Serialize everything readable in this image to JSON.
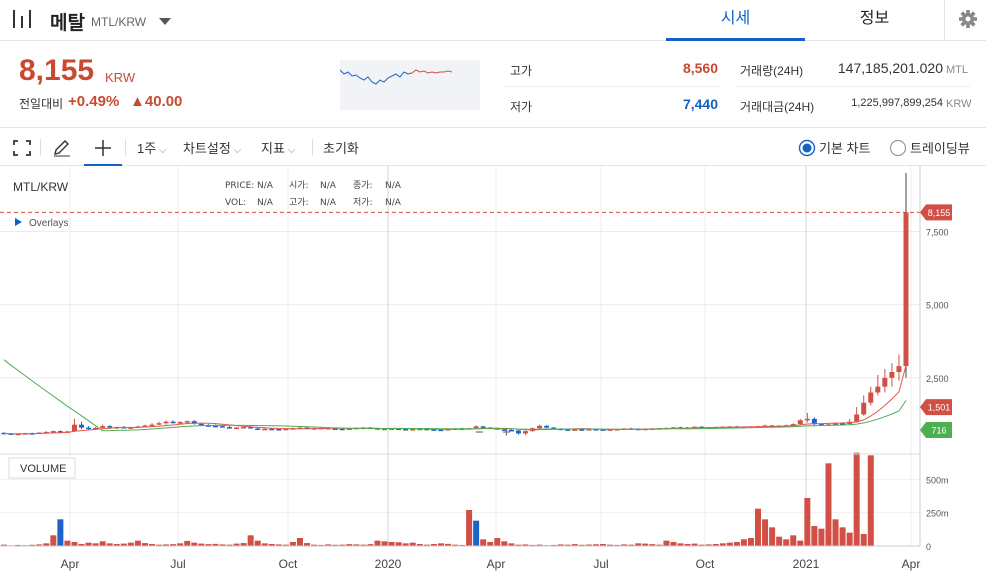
{
  "header": {
    "coin_name": "메탈",
    "pair": "MTL/KRW",
    "tabs": [
      "시세",
      "정보"
    ]
  },
  "summary": {
    "price": "8,155",
    "price_unit": "KRW",
    "change_label": "전일대비",
    "change_pct": "+0.49%",
    "change_abs": "▲40.00",
    "high_label": "고가",
    "high_value": "8,560",
    "low_label": "저가",
    "low_value": "7,440",
    "volume_label": "거래량(24H)",
    "volume_value": "147,185,201.020",
    "volume_unit": "MTL",
    "amount_label": "거래대금(24H)",
    "amount_value": "1,225,997,899,254",
    "amount_unit": "KRW"
  },
  "toolbar": {
    "interval": "1주",
    "chart_settings": "차트설정",
    "indicators": "지표",
    "reset": "초기화",
    "basic_chart": "기본 차트",
    "tradingview": "트레이딩뷰"
  },
  "chart": {
    "symbol": "MTL/KRW",
    "overlays": "Overlays",
    "legend": {
      "price_label": "PRICE:",
      "price_val": "N/A",
      "open_label": "시가:",
      "open_val": "N/A",
      "close_label": "종가:",
      "close_val": "N/A",
      "vol_label": "VOL:",
      "vol_val": "N/A",
      "high_label": "고가:",
      "high_val": "N/A",
      "low_label": "저가:",
      "low_val": "N/A"
    },
    "volume_label": "VOLUME",
    "zoom_out": "−",
    "zoom_in": "+",
    "colors": {
      "up": "#d24f45",
      "down": "#1e64c8",
      "ma_short": "#e8554e",
      "ma_long": "#4caf50",
      "price_tag": "#d24f45",
      "ma_long_tag": "#4caf50"
    }
  },
  "chart_data": {
    "type": "candlestick",
    "y_ticks": [
      "7,500",
      "5,000",
      "2,500"
    ],
    "y_tick_values": [
      7500,
      5000,
      2500
    ],
    "price_tags": [
      {
        "value": 8155,
        "label": "8,155",
        "series": "price"
      },
      {
        "value": 1501,
        "label": "1,501",
        "series": "ma_short"
      },
      {
        "value": 716,
        "label": "716",
        "series": "ma_long"
      }
    ],
    "volume_ticks": [
      "500m",
      "250m",
      "0"
    ],
    "volume_tick_values": [
      500,
      250,
      0
    ],
    "x_ticks": [
      "Apr",
      "Jul",
      "Oct",
      "2020",
      "Apr",
      "Jul",
      "Oct",
      "2021",
      "Apr"
    ],
    "ylim": [
      0,
      9500
    ],
    "volume_ylim": [
      0,
      600
    ],
    "candles": [
      [
        620,
        640,
        580,
        600
      ],
      [
        600,
        610,
        560,
        580
      ],
      [
        580,
        600,
        560,
        590
      ],
      [
        590,
        620,
        580,
        610
      ],
      [
        610,
        630,
        590,
        600
      ],
      [
        600,
        640,
        590,
        630
      ],
      [
        630,
        680,
        610,
        650
      ],
      [
        650,
        700,
        630,
        680
      ],
      [
        680,
        700,
        640,
        660
      ],
      [
        660,
        690,
        640,
        670
      ],
      [
        670,
        1100,
        650,
        900
      ],
      [
        900,
        1000,
        750,
        800
      ],
      [
        800,
        850,
        700,
        760
      ],
      [
        760,
        820,
        720,
        790
      ],
      [
        790,
        900,
        770,
        850
      ],
      [
        850,
        880,
        780,
        800
      ],
      [
        800,
        840,
        760,
        820
      ],
      [
        820,
        850,
        780,
        790
      ],
      [
        790,
        830,
        760,
        810
      ],
      [
        810,
        860,
        790,
        840
      ],
      [
        840,
        900,
        820,
        870
      ],
      [
        870,
        950,
        840,
        900
      ],
      [
        900,
        1000,
        880,
        950
      ],
      [
        950,
        1050,
        900,
        1000
      ],
      [
        1000,
        1050,
        940,
        960
      ],
      [
        960,
        1020,
        920,
        990
      ],
      [
        990,
        1040,
        960,
        1020
      ],
      [
        1020,
        1050,
        900,
        930
      ],
      [
        930,
        960,
        860,
        880
      ],
      [
        880,
        920,
        840,
        860
      ],
      [
        860,
        900,
        820,
        850
      ],
      [
        850,
        870,
        800,
        820
      ],
      [
        820,
        850,
        760,
        780
      ],
      [
        780,
        820,
        750,
        800
      ],
      [
        800,
        840,
        780,
        820
      ],
      [
        820,
        850,
        760,
        770
      ],
      [
        770,
        800,
        720,
        740
      ],
      [
        740,
        780,
        720,
        760
      ],
      [
        760,
        790,
        730,
        750
      ],
      [
        750,
        780,
        720,
        730
      ],
      [
        730,
        770,
        710,
        760
      ],
      [
        760,
        800,
        740,
        780
      ],
      [
        780,
        820,
        760,
        800
      ],
      [
        800,
        830,
        760,
        770
      ],
      [
        770,
        800,
        740,
        780
      ],
      [
        780,
        820,
        760,
        790
      ],
      [
        790,
        820,
        760,
        770
      ],
      [
        770,
        800,
        740,
        760
      ],
      [
        760,
        790,
        730,
        750
      ],
      [
        750,
        780,
        730,
        770
      ],
      [
        770,
        800,
        750,
        790
      ],
      [
        790,
        820,
        770,
        800
      ],
      [
        800,
        820,
        760,
        780
      ],
      [
        780,
        800,
        740,
        750
      ],
      [
        750,
        780,
        720,
        760
      ],
      [
        760,
        790,
        740,
        770
      ],
      [
        770,
        790,
        740,
        750
      ],
      [
        750,
        770,
        720,
        740
      ],
      [
        740,
        760,
        720,
        750
      ],
      [
        750,
        770,
        730,
        760
      ],
      [
        760,
        780,
        730,
        740
      ],
      [
        740,
        760,
        710,
        730
      ],
      [
        730,
        750,
        700,
        720
      ],
      [
        720,
        760,
        700,
        750
      ],
      [
        750,
        780,
        730,
        770
      ],
      [
        770,
        800,
        740,
        760
      ],
      [
        760,
        790,
        740,
        780
      ],
      [
        780,
        880,
        760,
        840
      ],
      [
        840,
        860,
        780,
        800
      ],
      [
        800,
        820,
        760,
        780
      ],
      [
        780,
        800,
        730,
        740
      ],
      [
        740,
        760,
        700,
        720
      ],
      [
        720,
        750,
        680,
        700
      ],
      [
        700,
        720,
        560,
        600
      ],
      [
        600,
        700,
        540,
        680
      ],
      [
        680,
        800,
        660,
        780
      ],
      [
        780,
        900,
        760,
        860
      ],
      [
        860,
        880,
        780,
        800
      ],
      [
        800,
        820,
        740,
        760
      ],
      [
        760,
        780,
        720,
        740
      ],
      [
        740,
        760,
        700,
        720
      ],
      [
        720,
        750,
        700,
        740
      ],
      [
        740,
        760,
        710,
        730
      ],
      [
        730,
        760,
        710,
        750
      ],
      [
        750,
        770,
        720,
        740
      ],
      [
        740,
        760,
        720,
        730
      ],
      [
        730,
        750,
        710,
        740
      ],
      [
        740,
        760,
        720,
        750
      ],
      [
        750,
        780,
        730,
        770
      ],
      [
        770,
        790,
        740,
        760
      ],
      [
        760,
        780,
        740,
        750
      ],
      [
        750,
        770,
        730,
        760
      ],
      [
        760,
        780,
        740,
        770
      ],
      [
        770,
        790,
        750,
        780
      ],
      [
        780,
        800,
        760,
        790
      ],
      [
        790,
        820,
        770,
        810
      ],
      [
        810,
        830,
        780,
        800
      ],
      [
        800,
        820,
        780,
        790
      ],
      [
        790,
        840,
        780,
        830
      ],
      [
        830,
        850,
        790,
        800
      ],
      [
        800,
        820,
        780,
        810
      ],
      [
        810,
        830,
        790,
        820
      ],
      [
        820,
        840,
        800,
        830
      ],
      [
        830,
        850,
        810,
        840
      ],
      [
        840,
        860,
        800,
        820
      ],
      [
        820,
        840,
        790,
        830
      ],
      [
        830,
        850,
        810,
        840
      ],
      [
        840,
        860,
        820,
        850
      ],
      [
        850,
        900,
        830,
        870
      ],
      [
        870,
        890,
        830,
        850
      ],
      [
        850,
        880,
        830,
        870
      ],
      [
        870,
        900,
        850,
        880
      ],
      [
        880,
        950,
        860,
        920
      ],
      [
        920,
        1100,
        900,
        1050
      ],
      [
        1050,
        1300,
        980,
        1100
      ],
      [
        1100,
        1150,
        880,
        920
      ],
      [
        920,
        950,
        860,
        900
      ],
      [
        900,
        930,
        860,
        910
      ],
      [
        910,
        960,
        890,
        940
      ],
      [
        940,
        980,
        900,
        920
      ],
      [
        920,
        1100,
        900,
        1000
      ],
      [
        1000,
        1500,
        980,
        1250
      ],
      [
        1250,
        1900,
        1200,
        1650
      ],
      [
        1650,
        2200,
        1550,
        2000
      ],
      [
        2000,
        2600,
        1900,
        2200
      ],
      [
        2200,
        2800,
        2000,
        2500
      ],
      [
        2500,
        3000,
        2200,
        2700
      ],
      [
        2700,
        3300,
        2400,
        2900
      ],
      [
        2900,
        9500,
        2500,
        8155
      ]
    ],
    "volumes": [
      [
        10,
        1
      ],
      [
        5,
        1
      ],
      [
        8,
        1
      ],
      [
        6,
        1
      ],
      [
        9,
        1
      ],
      [
        12,
        1
      ],
      [
        20,
        1
      ],
      [
        80,
        1
      ],
      [
        200,
        -1
      ],
      [
        40,
        1
      ],
      [
        30,
        1
      ],
      [
        15,
        1
      ],
      [
        25,
        1
      ],
      [
        20,
        1
      ],
      [
        35,
        1
      ],
      [
        20,
        1
      ],
      [
        15,
        1
      ],
      [
        18,
        1
      ],
      [
        25,
        1
      ],
      [
        40,
        1
      ],
      [
        22,
        1
      ],
      [
        15,
        1
      ],
      [
        10,
        1
      ],
      [
        12,
        1
      ],
      [
        14,
        1
      ],
      [
        20,
        1
      ],
      [
        38,
        1
      ],
      [
        25,
        1
      ],
      [
        18,
        1
      ],
      [
        14,
        1
      ],
      [
        16,
        1
      ],
      [
        12,
        1
      ],
      [
        10,
        1
      ],
      [
        18,
        1
      ],
      [
        22,
        1
      ],
      [
        80,
        1
      ],
      [
        40,
        1
      ],
      [
        20,
        1
      ],
      [
        15,
        1
      ],
      [
        12,
        1
      ],
      [
        10,
        1
      ],
      [
        30,
        1
      ],
      [
        60,
        1
      ],
      [
        22,
        1
      ],
      [
        10,
        1
      ],
      [
        8,
        1
      ],
      [
        12,
        1
      ],
      [
        9,
        1
      ],
      [
        10,
        1
      ],
      [
        14,
        1
      ],
      [
        12,
        1
      ],
      [
        10,
        1
      ],
      [
        14,
        1
      ],
      [
        40,
        1
      ],
      [
        35,
        1
      ],
      [
        30,
        1
      ],
      [
        28,
        1
      ],
      [
        20,
        1
      ],
      [
        25,
        1
      ],
      [
        15,
        1
      ],
      [
        10,
        1
      ],
      [
        15,
        1
      ],
      [
        20,
        1
      ],
      [
        16,
        1
      ],
      [
        10,
        1
      ],
      [
        8,
        1
      ],
      [
        270,
        1
      ],
      [
        190,
        -1
      ],
      [
        50,
        1
      ],
      [
        30,
        1
      ],
      [
        60,
        1
      ],
      [
        35,
        1
      ],
      [
        20,
        1
      ],
      [
        10,
        1
      ],
      [
        12,
        1
      ],
      [
        8,
        1
      ],
      [
        10,
        1
      ],
      [
        6,
        1
      ],
      [
        8,
        1
      ],
      [
        12,
        1
      ],
      [
        10,
        1
      ],
      [
        14,
        1
      ],
      [
        9,
        1
      ],
      [
        11,
        1
      ],
      [
        13,
        1
      ],
      [
        15,
        1
      ],
      [
        10,
        1
      ],
      [
        8,
        1
      ],
      [
        12,
        1
      ],
      [
        10,
        1
      ],
      [
        20,
        1
      ],
      [
        18,
        1
      ],
      [
        14,
        1
      ],
      [
        10,
        1
      ],
      [
        40,
        1
      ],
      [
        30,
        1
      ],
      [
        20,
        1
      ],
      [
        15,
        1
      ],
      [
        18,
        1
      ],
      [
        10,
        1
      ],
      [
        12,
        1
      ],
      [
        15,
        1
      ],
      [
        20,
        1
      ],
      [
        25,
        1
      ],
      [
        30,
        1
      ],
      [
        50,
        1
      ],
      [
        60,
        1
      ],
      [
        280,
        1
      ],
      [
        200,
        1
      ],
      [
        140,
        1
      ],
      [
        70,
        1
      ],
      [
        50,
        1
      ],
      [
        80,
        1
      ],
      [
        40,
        1
      ],
      [
        360,
        1
      ],
      [
        150,
        1
      ],
      [
        130,
        1
      ],
      [
        620,
        1
      ],
      [
        200,
        1
      ],
      [
        140,
        1
      ],
      [
        100,
        1
      ],
      [
        700,
        1
      ],
      [
        90,
        1
      ],
      [
        680,
        1
      ]
    ]
  }
}
